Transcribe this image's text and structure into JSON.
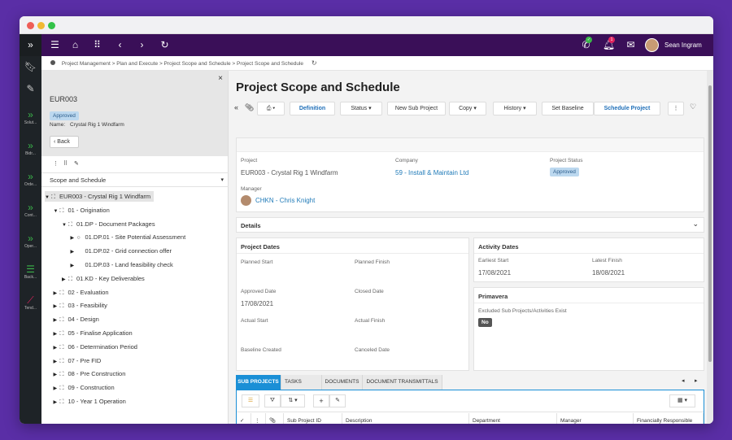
{
  "user": {
    "name": "Sean Ingram"
  },
  "appbar": {
    "phone_badge": "✓",
    "bell_badge": "1"
  },
  "rail": [
    {
      "icon": "chevrons-icon",
      "label": "Solut..."
    },
    {
      "icon": "chevrons-icon",
      "label": "Bidr..."
    },
    {
      "icon": "chevrons-icon",
      "label": "Orde..."
    },
    {
      "icon": "chevrons-icon",
      "label": "Cont..."
    },
    {
      "icon": "chevrons-icon",
      "label": "Oper..."
    },
    {
      "icon": "list-icon",
      "label": "Back..."
    },
    {
      "icon": "chart-icon",
      "label": "Tend..."
    }
  ],
  "breadcrumb": "Project Management > Plan and Execute > Project Scope and Schedule > Project Scope and Schedule",
  "left": {
    "code": "EUR003",
    "status": "Approved",
    "name_label": "Name:",
    "name_value": "Crystal Rig 1 Windfarm",
    "back": "Back",
    "section_select": "Scope and Schedule",
    "tree": [
      {
        "label": "EUR003 - Crystal Rig 1 Windfarm",
        "level": 0,
        "expanded": true,
        "selected": true
      },
      {
        "label": "01 - Origination",
        "level": 1,
        "expanded": true
      },
      {
        "label": "01.DP - Document Packages",
        "level": 2,
        "expanded": true
      },
      {
        "label": "01.DP.01 - Site Potential Assessment",
        "level": 3,
        "circle": true
      },
      {
        "label": "01.DP.02 - Grid connection offer",
        "level": 3
      },
      {
        "label": "01.DP.03 - Land feasibility check",
        "level": 3
      },
      {
        "label": "01.KD - Key Deliverables",
        "level": 2
      },
      {
        "label": "02 - Evaluation",
        "level": 1
      },
      {
        "label": "03 - Feasibility",
        "level": 1
      },
      {
        "label": "04 - Design",
        "level": 1
      },
      {
        "label": "05 - Finalise Application",
        "level": 1
      },
      {
        "label": "06 - Determination Period",
        "level": 1
      },
      {
        "label": "07 - Pre FID",
        "level": 1
      },
      {
        "label": "08 - Pre Construction",
        "level": 1
      },
      {
        "label": "09 - Construction",
        "level": 1
      },
      {
        "label": "10 - Year 1 Operation",
        "level": 1
      }
    ]
  },
  "main": {
    "title": "Project Scope and Schedule",
    "toolbar": {
      "definition": "Definition",
      "status": "Status",
      "new_sub": "New Sub Project",
      "copy": "Copy",
      "history": "History",
      "set_baseline": "Set Baseline",
      "schedule": "Schedule Project"
    },
    "header": {
      "project_label": "Project",
      "project_value": "EUR003 - Crystal Rig 1 Windfarm",
      "company_label": "Company",
      "company_value": "59 - Install & Maintain Ltd",
      "status_label": "Project Status",
      "status_value": "Approved",
      "manager_label": "Manager",
      "manager_value": "CHKN - Chris Knight"
    },
    "details_label": "Details",
    "project_dates": {
      "title": "Project Dates",
      "planned_start": "Planned Start",
      "planned_finish": "Planned Finish",
      "approved_date": "Approved Date",
      "approved_value": "17/08/2021",
      "closed_date": "Closed Date",
      "actual_start": "Actual Start",
      "actual_finish": "Actual Finish",
      "baseline_created": "Baseline Created",
      "canceled_date": "Canceled Date"
    },
    "activity_dates": {
      "title": "Activity Dates",
      "earliest_start": "Earliest Start",
      "earliest_value": "17/08/2021",
      "latest_finish": "Latest Finish",
      "latest_value": "18/08/2021"
    },
    "primavera": {
      "title": "Primavera",
      "excluded_label": "Excluded Sub Projects/Activities Exist",
      "excluded_value": "No"
    },
    "tabs": [
      "SUB PROJECTS",
      "TASKS",
      "DOCUMENTS",
      "DOCUMENT TRANSMITTALS"
    ],
    "grid_columns": [
      "Sub Project ID",
      "Description",
      "Department",
      "Manager",
      "Financially Responsible"
    ]
  },
  "colors": {
    "appbar": "#3a0f58",
    "rail": "#1e2327",
    "accent": "#1a8fd6",
    "badge": "#bcd8ef"
  }
}
